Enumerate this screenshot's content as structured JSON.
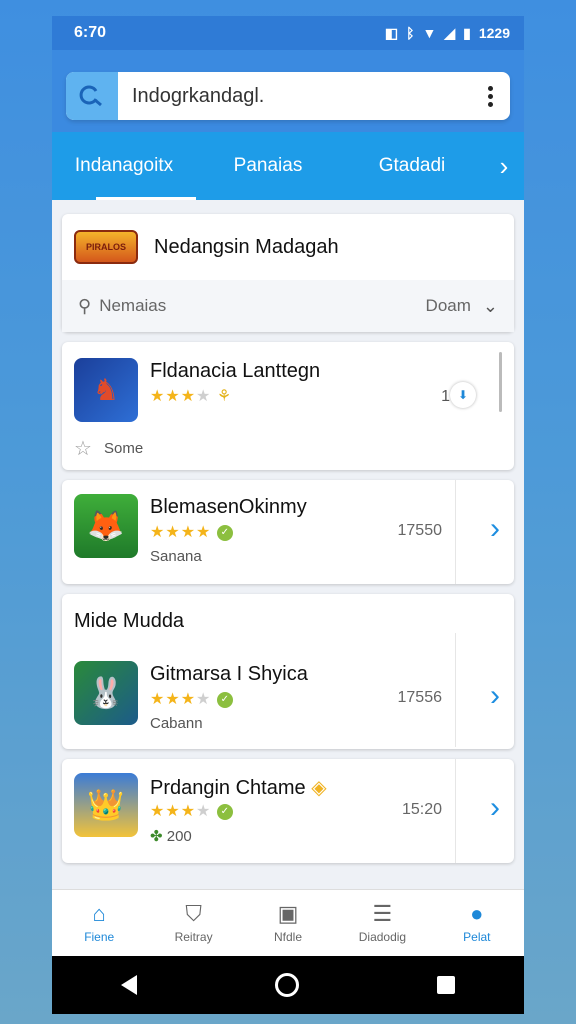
{
  "status": {
    "time": "6:70",
    "clock": "1229"
  },
  "search": {
    "value": "Indogrkandagl."
  },
  "tabs": [
    {
      "label": "Indanagoitx"
    },
    {
      "label": "Panaias"
    },
    {
      "label": "Gtadadi"
    }
  ],
  "featured": {
    "logo_text": "PIRALOS",
    "title": "Nedangsin Madagah"
  },
  "filter": {
    "label": "Nemaias",
    "value": "Doam"
  },
  "apps": [
    {
      "title": "Fldanacia Lanttegn",
      "rating": 3.5,
      "sub": "Some",
      "count": "1"
    },
    {
      "title": "BlemasenOkinmy",
      "rating": 4,
      "sub": "Sanana",
      "count": "17550"
    }
  ],
  "section": {
    "title": "Mide Mudda"
  },
  "section_apps": [
    {
      "title": "Gitmarsa I Shyica",
      "rating": 3.5,
      "sub": "Cabann",
      "count": "17556"
    },
    {
      "title": "Prdangin Chtame",
      "rating": 3.5,
      "sub": "200",
      "count": "15:20"
    }
  ],
  "bottom_nav": [
    {
      "label": "Fiene",
      "icon": "home-icon"
    },
    {
      "label": "Reitray",
      "icon": "shield-icon"
    },
    {
      "label": "Nfdle",
      "icon": "bag-icon"
    },
    {
      "label": "Diadodig",
      "icon": "list-icon"
    },
    {
      "label": "Pelat",
      "icon": "profile-icon"
    }
  ],
  "colors": {
    "accent": "#1e9ce8",
    "header": "#3b8ae0",
    "star": "#f4b41a"
  }
}
